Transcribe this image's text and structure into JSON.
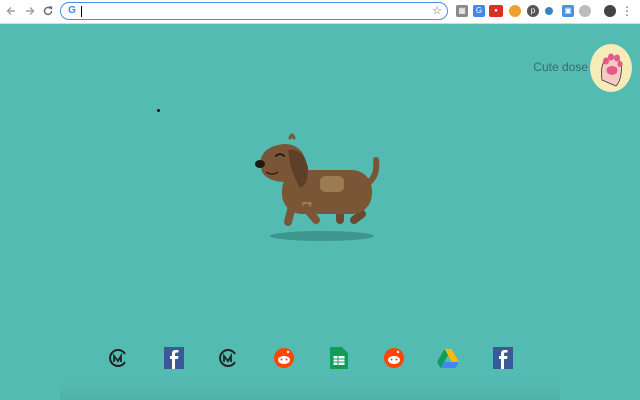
{
  "browser": {
    "address_bar": {
      "value": "",
      "placeholder": ""
    },
    "extensions": [
      "ext-1-icon",
      "translate-icon",
      "pomodoro-icon",
      "cookie-icon",
      "pinterest-icon",
      "extension-icon",
      "extension-icon-2",
      "extension-icon-3"
    ]
  },
  "widget": {
    "label": "Cute dose"
  },
  "shortcuts": [
    {
      "name": "coinmarketcap",
      "icon": "coinmarketcap-icon"
    },
    {
      "name": "facebook",
      "icon": "facebook-icon"
    },
    {
      "name": "coinmarketcap",
      "icon": "coinmarketcap-icon"
    },
    {
      "name": "reddit",
      "icon": "reddit-icon"
    },
    {
      "name": "google-sheets",
      "icon": "google-sheets-icon"
    },
    {
      "name": "reddit",
      "icon": "reddit-icon"
    },
    {
      "name": "google-drive",
      "icon": "google-drive-icon"
    },
    {
      "name": "facebook",
      "icon": "facebook-icon"
    }
  ],
  "colors": {
    "background": "#54bbb3",
    "dog_body": "#7a5637",
    "dog_spot": "#9c7a52"
  }
}
